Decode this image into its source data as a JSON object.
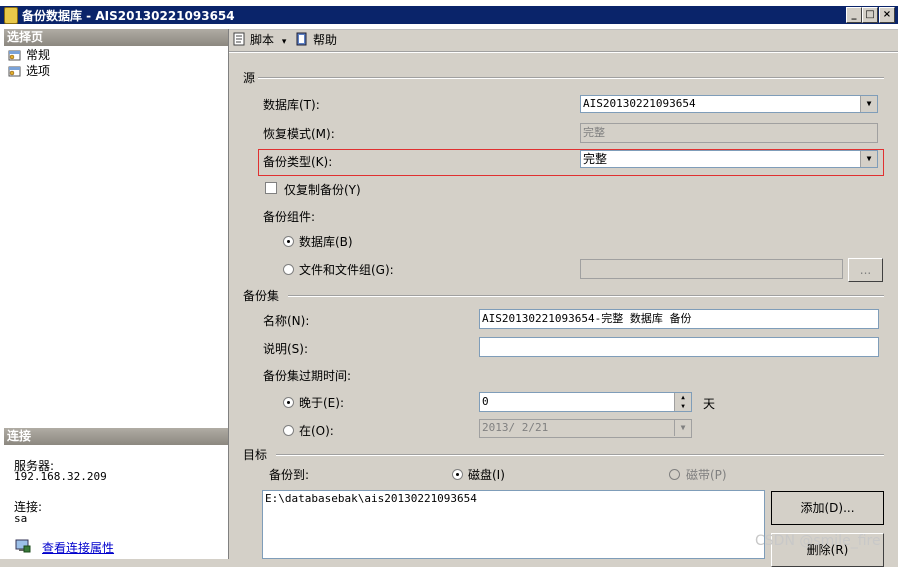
{
  "window": {
    "title": "备份数据库 - AIS20130221093654",
    "minimize": "_",
    "maximize": "□",
    "close": "×"
  },
  "left": {
    "select_page_header": "选择页",
    "pages": [
      {
        "label": "常规",
        "icon": "page-gear-icon"
      },
      {
        "label": "选项",
        "icon": "page-gear-icon"
      }
    ],
    "connection_header": "连接",
    "server_label": "服务器:",
    "server_value": "192.168.32.209",
    "connection_label": "连接:",
    "connection_value": "sa",
    "view_props_link": "查看连接属性"
  },
  "toolbar": {
    "script_label": "脚本",
    "script_dropdown": "▾",
    "help_label": "帮助"
  },
  "source": {
    "group_label": "源",
    "database_label": "数据库(T):",
    "database_value": "AIS20130221093654",
    "recovery_label": "恢复模式(M):",
    "recovery_value": "完整",
    "backup_type_label": "备份类型(K):",
    "backup_type_value": "完整",
    "copy_only_label": "仅复制备份(Y)",
    "copy_only_checked": false,
    "component_label": "备份组件:",
    "component_database_label": "数据库(B)",
    "component_database_selected": true,
    "component_files_label": "文件和文件组(G):",
    "component_files_value": "",
    "browse_label": "..."
  },
  "backup_set": {
    "group_label": "备份集",
    "name_label": "名称(N):",
    "name_value": "AIS20130221093654-完整 数据库 备份",
    "description_label": "说明(S):",
    "description_value": "",
    "expire_label": "备份集过期时间:",
    "after_label": "晚于(E):",
    "after_selected": true,
    "after_value": "0",
    "days_label": "天",
    "on_label": "在(O):",
    "on_value": "2013/ 2/21"
  },
  "destination": {
    "group_label": "目标",
    "backup_to_label": "备份到:",
    "disk_label": "磁盘(I)",
    "disk_selected": true,
    "tape_label": "磁带(P)",
    "paths": [
      "E:\\databasebak\\ais20130221093654"
    ],
    "add_button": "添加(D)...",
    "remove_button": "删除(R)"
  },
  "colors": {
    "title_bar": "#0a246a",
    "highlight_border": "#e03030",
    "link": "#0000cc"
  },
  "watermark": "CSDN @smile_fire"
}
